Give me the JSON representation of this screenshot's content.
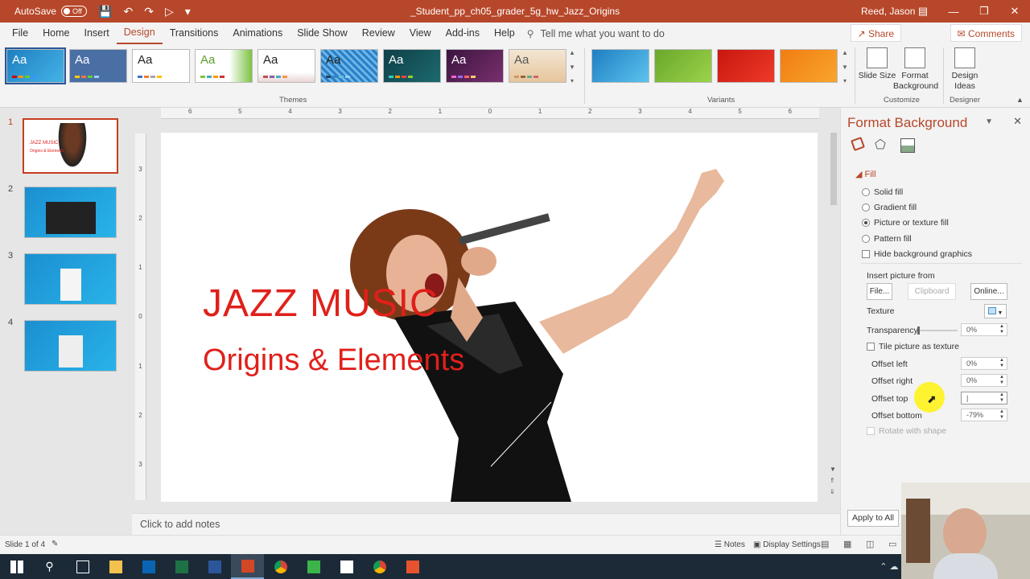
{
  "titlebar": {
    "autosave_label": "AutoSave",
    "autosave_state": "Off",
    "doc_title": "_Student_pp_ch05_grader_5g_hw_Jazz_Origins",
    "user": "Reed, Jason"
  },
  "menu": {
    "tabs": [
      "File",
      "Home",
      "Insert",
      "Design",
      "Transitions",
      "Animations",
      "Slide Show",
      "Review",
      "View",
      "Add-ins",
      "Help"
    ],
    "active": "Design",
    "tell_me": "Tell me what you want to do",
    "share": "Share",
    "comments": "Comments"
  },
  "ribbon": {
    "themes_label": "Themes",
    "variants_label": "Variants",
    "customize_label": "Customize",
    "designer_label": "Designer",
    "theme_sample": "Aa",
    "slide_size": "Slide Size",
    "format_background": "Format Background",
    "design_ideas": "Design Ideas"
  },
  "slides": {
    "numbers": [
      "1",
      "2",
      "3",
      "4"
    ],
    "thumb1_title": "JAZZ MUSIC",
    "thumb1_sub": "Origins & Elements"
  },
  "slide": {
    "title": "JAZZ MUSIC",
    "subtitle": "Origins & Elements"
  },
  "notes_placeholder": "Click to add notes",
  "pane": {
    "title": "Format Background",
    "fill_section": "Fill",
    "solid_fill": "Solid fill",
    "gradient_fill": "Gradient fill",
    "picture_fill": "Picture or texture fill",
    "pattern_fill": "Pattern fill",
    "hide_bg": "Hide background graphics",
    "insert_from": "Insert picture from",
    "file_btn": "File...",
    "clipboard_btn": "Clipboard",
    "online_btn": "Online...",
    "texture": "Texture",
    "transparency": "Transparency",
    "transparency_val": "0%",
    "tile": "Tile picture as texture",
    "offset_left": "Offset left",
    "offset_left_val": "0%",
    "offset_right": "Offset right",
    "offset_right_val": "0%",
    "offset_top": "Offset top",
    "offset_top_val": "|",
    "offset_bottom": "Offset bottom",
    "offset_bottom_val": "-79%",
    "rotate": "Rotate with shape",
    "apply_all": "Apply to All"
  },
  "statusbar": {
    "slide_count": "Slide 1 of 4",
    "notes": "Notes",
    "display_settings": "Display Settings"
  },
  "ruler_top_labels": [
    "6",
    "5",
    "4",
    "3",
    "2",
    "1",
    "0",
    "1",
    "2",
    "3",
    "4",
    "5",
    "6"
  ],
  "ruler_left_labels": [
    "3",
    "2",
    "1",
    "0",
    "1",
    "2",
    "3"
  ]
}
